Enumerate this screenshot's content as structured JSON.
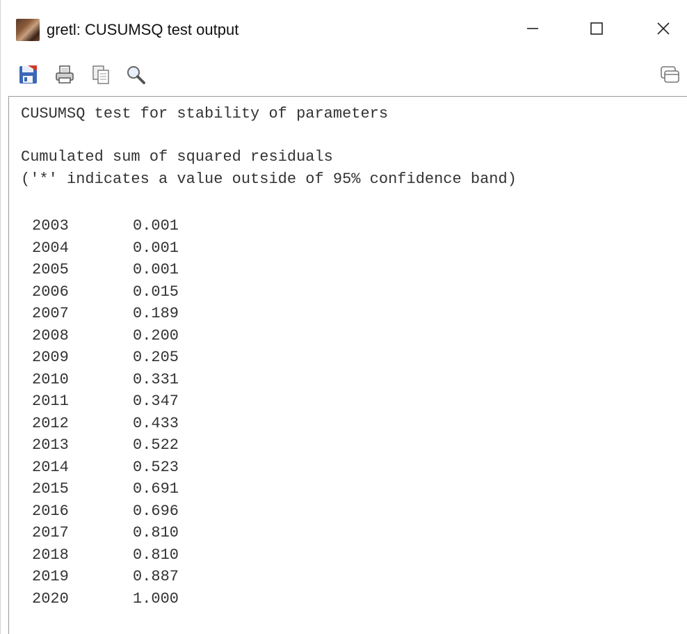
{
  "window": {
    "title": "gretl: CUSUMSQ test output",
    "controls": {
      "minimize_icon": "minimize-icon",
      "maximize_icon": "maximize-icon",
      "close_icon": "close-icon"
    }
  },
  "toolbar": {
    "items": [
      {
        "name": "save-as-icon"
      },
      {
        "name": "print-icon"
      },
      {
        "name": "copy-icon"
      },
      {
        "name": "find-icon"
      },
      {
        "name": "window-list-icon"
      }
    ]
  },
  "output": {
    "heading": "CUSUMSQ test for stability of parameters",
    "subtitle": "Cumulated sum of squared residuals",
    "note": "('*' indicates a value outside of 95% confidence band)",
    "rows": [
      {
        "year": "2003",
        "value": "0.001"
      },
      {
        "year": "2004",
        "value": "0.001"
      },
      {
        "year": "2005",
        "value": "0.001"
      },
      {
        "year": "2006",
        "value": "0.015"
      },
      {
        "year": "2007",
        "value": "0.189"
      },
      {
        "year": "2008",
        "value": "0.200"
      },
      {
        "year": "2009",
        "value": "0.205"
      },
      {
        "year": "2010",
        "value": "0.331"
      },
      {
        "year": "2011",
        "value": "0.347"
      },
      {
        "year": "2012",
        "value": "0.433"
      },
      {
        "year": "2013",
        "value": "0.522"
      },
      {
        "year": "2014",
        "value": "0.523"
      },
      {
        "year": "2015",
        "value": "0.691"
      },
      {
        "year": "2016",
        "value": "0.696"
      },
      {
        "year": "2017",
        "value": "0.810"
      },
      {
        "year": "2018",
        "value": "0.810"
      },
      {
        "year": "2019",
        "value": "0.887"
      },
      {
        "year": "2020",
        "value": "1.000"
      }
    ]
  }
}
